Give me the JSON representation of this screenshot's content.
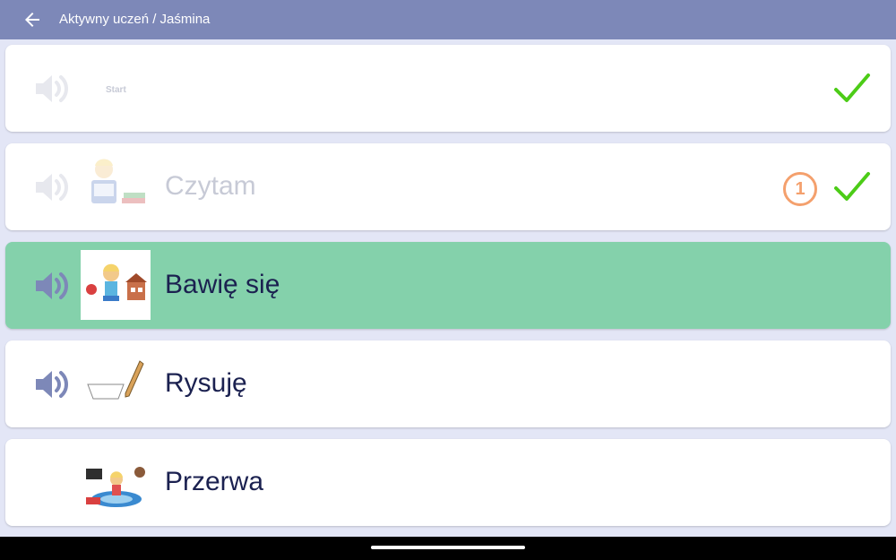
{
  "header": {
    "title": "Aktywny uczeń / Jaśmina"
  },
  "rows": [
    {
      "label": "Start",
      "state": "done",
      "count": ""
    },
    {
      "label": "Czytam",
      "state": "done",
      "count": "1"
    },
    {
      "label": "Bawię się",
      "state": "active",
      "count": ""
    },
    {
      "label": "Rysuję",
      "state": "pending",
      "count": ""
    },
    {
      "label": "Przerwa",
      "state": "pending",
      "count": ""
    }
  ],
  "colors": {
    "header": "#7d88b8",
    "background": "#e3e6f6",
    "active_row": "#84d1ab",
    "check": "#4ccc17",
    "counter": "#f4a06d",
    "speaker": "#7d88b8"
  },
  "icons": {
    "back": "arrow-left-icon",
    "speaker": "speaker-icon",
    "check": "checkmark-icon"
  }
}
